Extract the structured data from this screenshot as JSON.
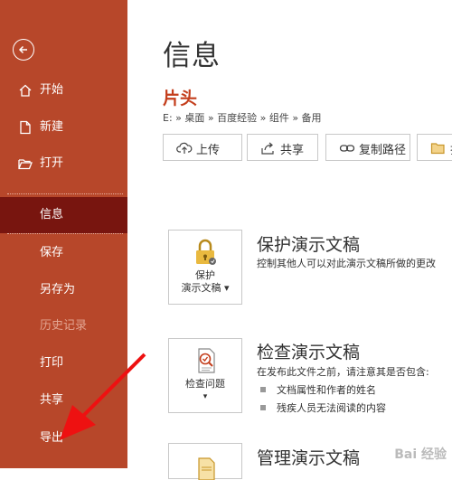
{
  "sidebar": {
    "items": [
      {
        "label": "开始",
        "icon": "home-icon"
      },
      {
        "label": "新建",
        "icon": "new-document-icon"
      },
      {
        "label": "打开",
        "icon": "open-folder-icon"
      },
      {
        "label": "信息"
      },
      {
        "label": "保存"
      },
      {
        "label": "另存为"
      },
      {
        "label": "历史记录"
      },
      {
        "label": "打印"
      },
      {
        "label": "共享"
      },
      {
        "label": "导出"
      }
    ],
    "active": "信息",
    "background": "#b7472a",
    "active_background": "#78150f"
  },
  "main": {
    "title": "信息",
    "doc_name": "片头",
    "path": "E: » 桌面 » 百度经验 » 组件 » 备用",
    "actions": [
      {
        "label": "上传",
        "icon": "cloud-upload-icon"
      },
      {
        "label": "共享",
        "icon": "share-icon"
      },
      {
        "label": "复制路径",
        "icon": "link-icon"
      },
      {
        "label": "打",
        "icon": "folder-icon"
      }
    ],
    "sections": [
      {
        "card_label_1": "保护",
        "card_label_2": "演示文稿 ▾",
        "title": "保护演示文稿",
        "desc": "控制其他人可以对此演示文稿所做的更改"
      },
      {
        "card_label_1": "检查问题",
        "card_label_2": "▾",
        "title": "检查演示文稿",
        "desc": "在发布此文件之前，请注意其是否包含:",
        "bullets": [
          "文档属性和作者的姓名",
          "残疾人员无法阅读的内容"
        ]
      },
      {
        "title": "管理演示文稿"
      }
    ]
  },
  "watermark": "Bai 经验",
  "accent": "#c43e1c"
}
